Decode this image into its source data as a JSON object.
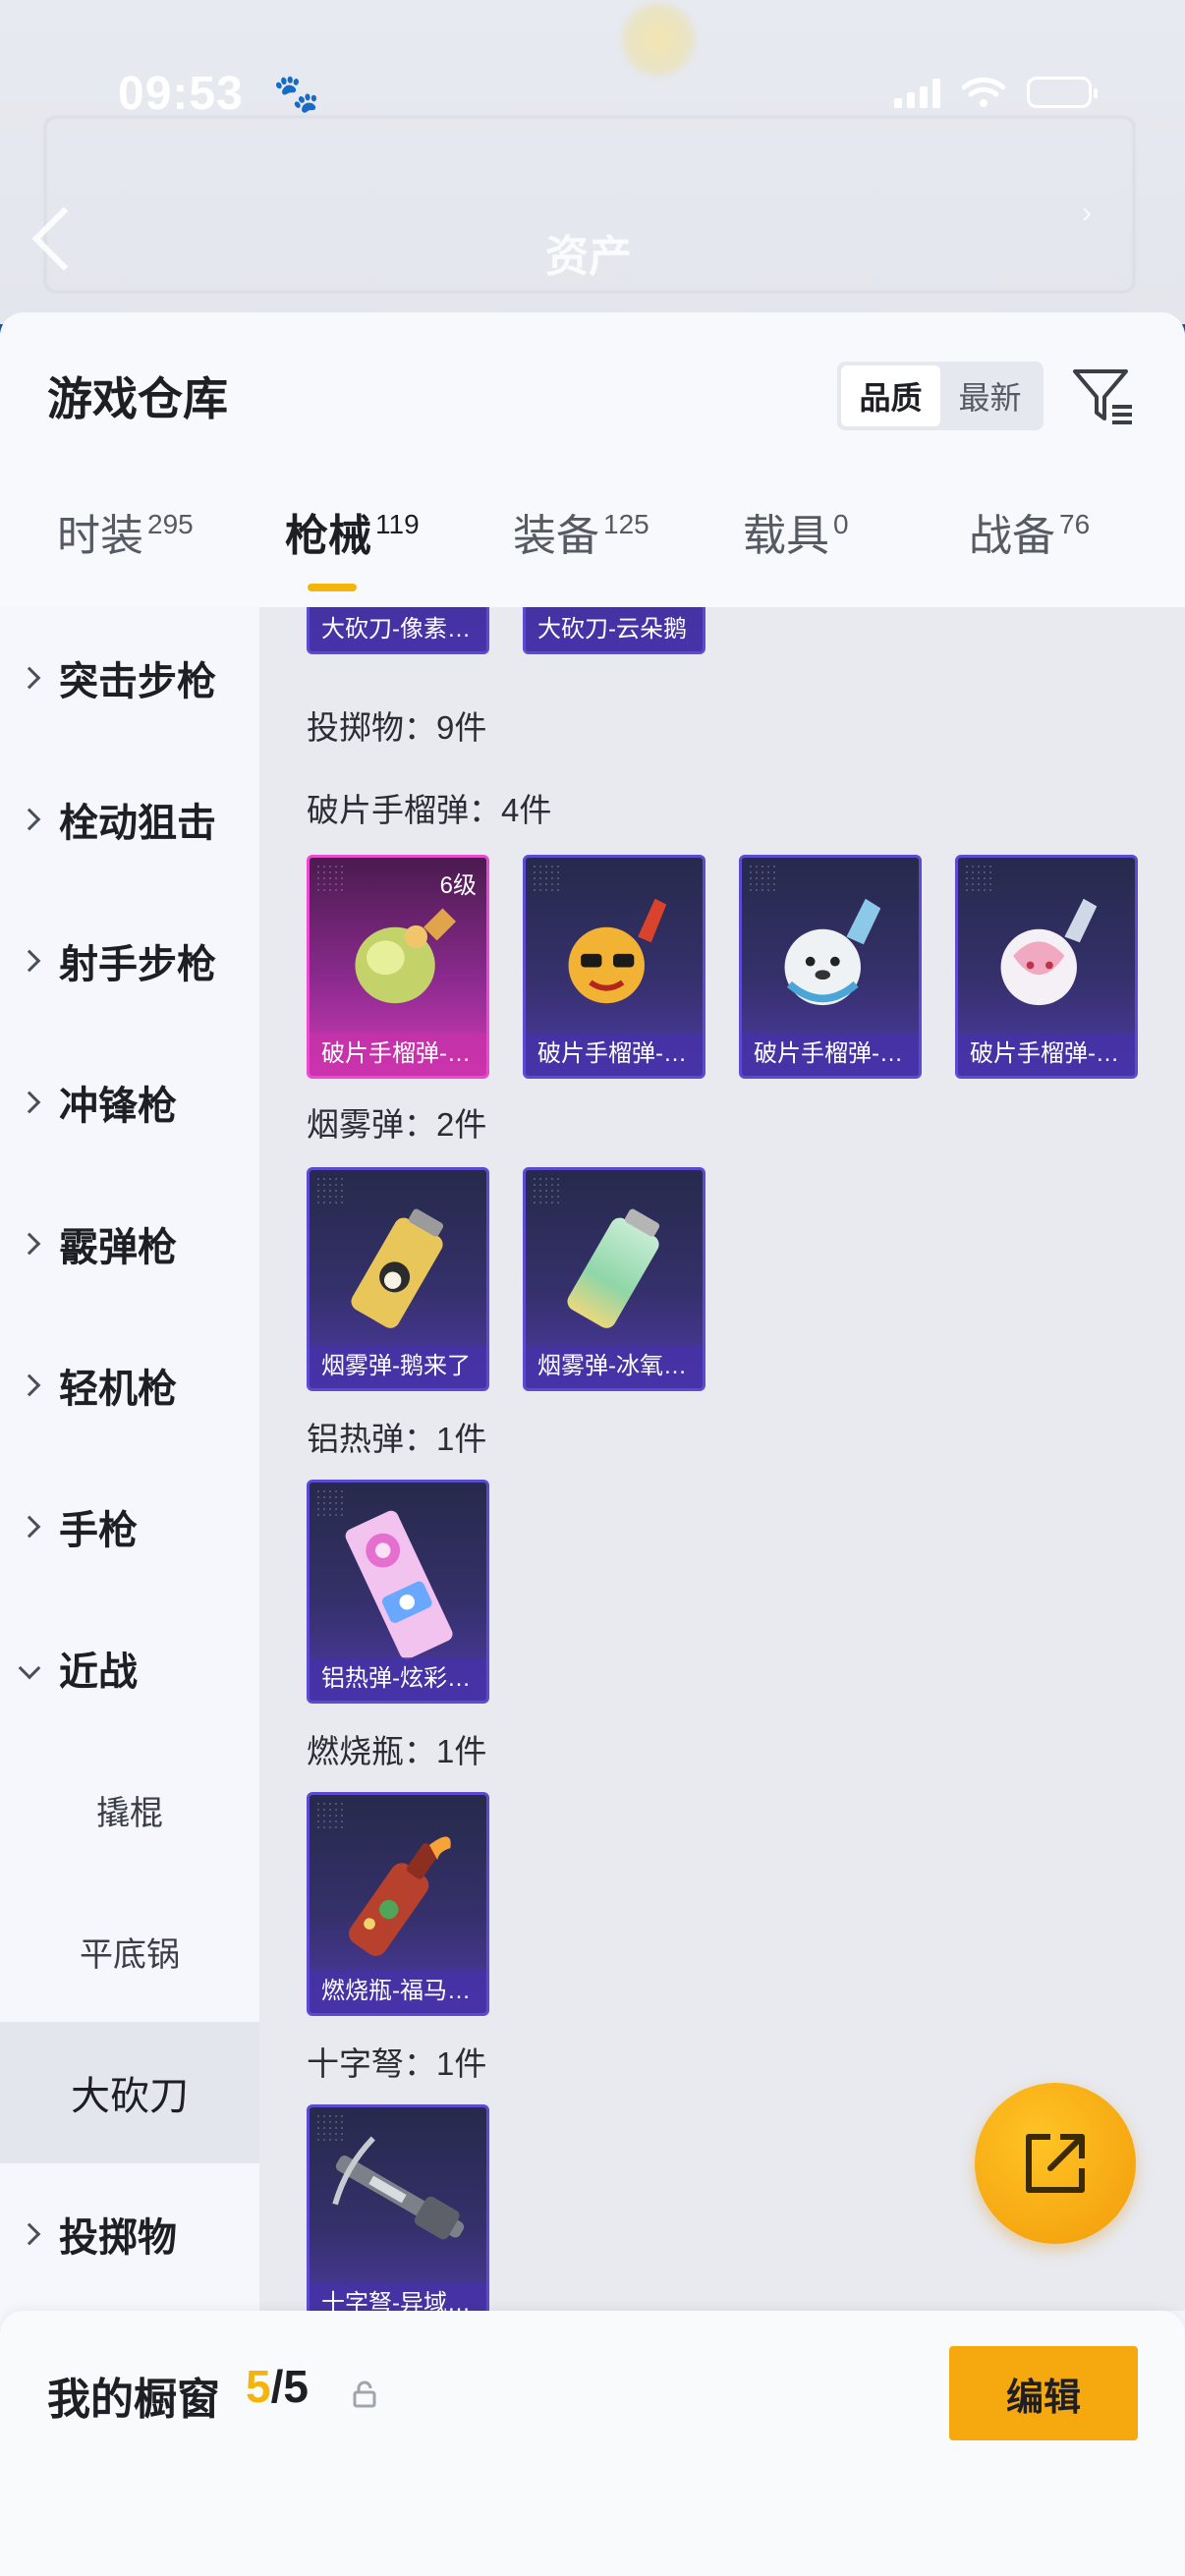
{
  "status_bar": {
    "time": "09:53"
  },
  "background_page": {
    "title": "资产"
  },
  "sheet": {
    "title": "游戏仓库",
    "sort_options": [
      {
        "label": "品质",
        "active": true
      },
      {
        "label": "最新",
        "active": false
      }
    ],
    "filter_icon": "filter-icon"
  },
  "tabs": [
    {
      "label": "时装",
      "count": "295",
      "active": false
    },
    {
      "label": "枪械",
      "count": "119",
      "active": true
    },
    {
      "label": "装备",
      "count": "125",
      "active": false
    },
    {
      "label": "载具",
      "count": "0",
      "active": false
    },
    {
      "label": "战备",
      "count": "76",
      "active": false
    }
  ],
  "sidenav": {
    "items": [
      {
        "label": "突击步枪",
        "expanded": false
      },
      {
        "label": "栓动狙击",
        "expanded": false
      },
      {
        "label": "射手步枪",
        "expanded": false
      },
      {
        "label": "冲锋枪",
        "expanded": false
      },
      {
        "label": "霰弹枪",
        "expanded": false
      },
      {
        "label": "轻机枪",
        "expanded": false
      },
      {
        "label": "手枪",
        "expanded": false
      },
      {
        "label": "近战",
        "expanded": true
      }
    ],
    "sub_items": [
      {
        "label": "撬棍",
        "selected": false
      },
      {
        "label": "平底锅",
        "selected": false
      },
      {
        "label": "大砍刀",
        "selected": true
      }
    ],
    "after_items": [
      {
        "label": "投掷物",
        "expanded": false
      }
    ]
  },
  "content": {
    "top_cards": [
      "大砍刀-像素…",
      "大砍刀-云朵鹅"
    ],
    "throwables_title": "投掷物：9件",
    "sections": [
      {
        "title": "破片手榴弹：4件",
        "items": [
          {
            "name": "破片手榴弹-…",
            "level": "6级",
            "rarity": "gold"
          },
          {
            "name": "破片手榴弹-…",
            "rarity": "purple"
          },
          {
            "name": "破片手榴弹-…",
            "rarity": "purple"
          },
          {
            "name": "破片手榴弹-…",
            "rarity": "purple"
          }
        ]
      },
      {
        "title": "烟雾弹：2件",
        "items": [
          {
            "name": "烟雾弹-鹅来了",
            "rarity": "purple"
          },
          {
            "name": "烟雾弹-冰氧…",
            "rarity": "purple"
          }
        ]
      },
      {
        "title": "铝热弹：1件",
        "items": [
          {
            "name": "铝热弹-炫彩…",
            "rarity": "purple"
          }
        ]
      },
      {
        "title": "燃烧瓶：1件",
        "items": [
          {
            "name": "燃烧瓶-福马…",
            "rarity": "purple"
          }
        ]
      },
      {
        "title": "十字弩：1件",
        "items": [
          {
            "name": "十字弩-异域…",
            "rarity": "purple"
          }
        ]
      }
    ]
  },
  "fab": {
    "icon": "share-external-icon"
  },
  "footer": {
    "label": "我的橱窗",
    "current": "5",
    "separator": "/",
    "total": "5",
    "edit_label": "编辑"
  },
  "colors": {
    "accent": "#f6a90f",
    "purple_card": "#4e3aa6",
    "gold_card": "#d23ab9"
  }
}
